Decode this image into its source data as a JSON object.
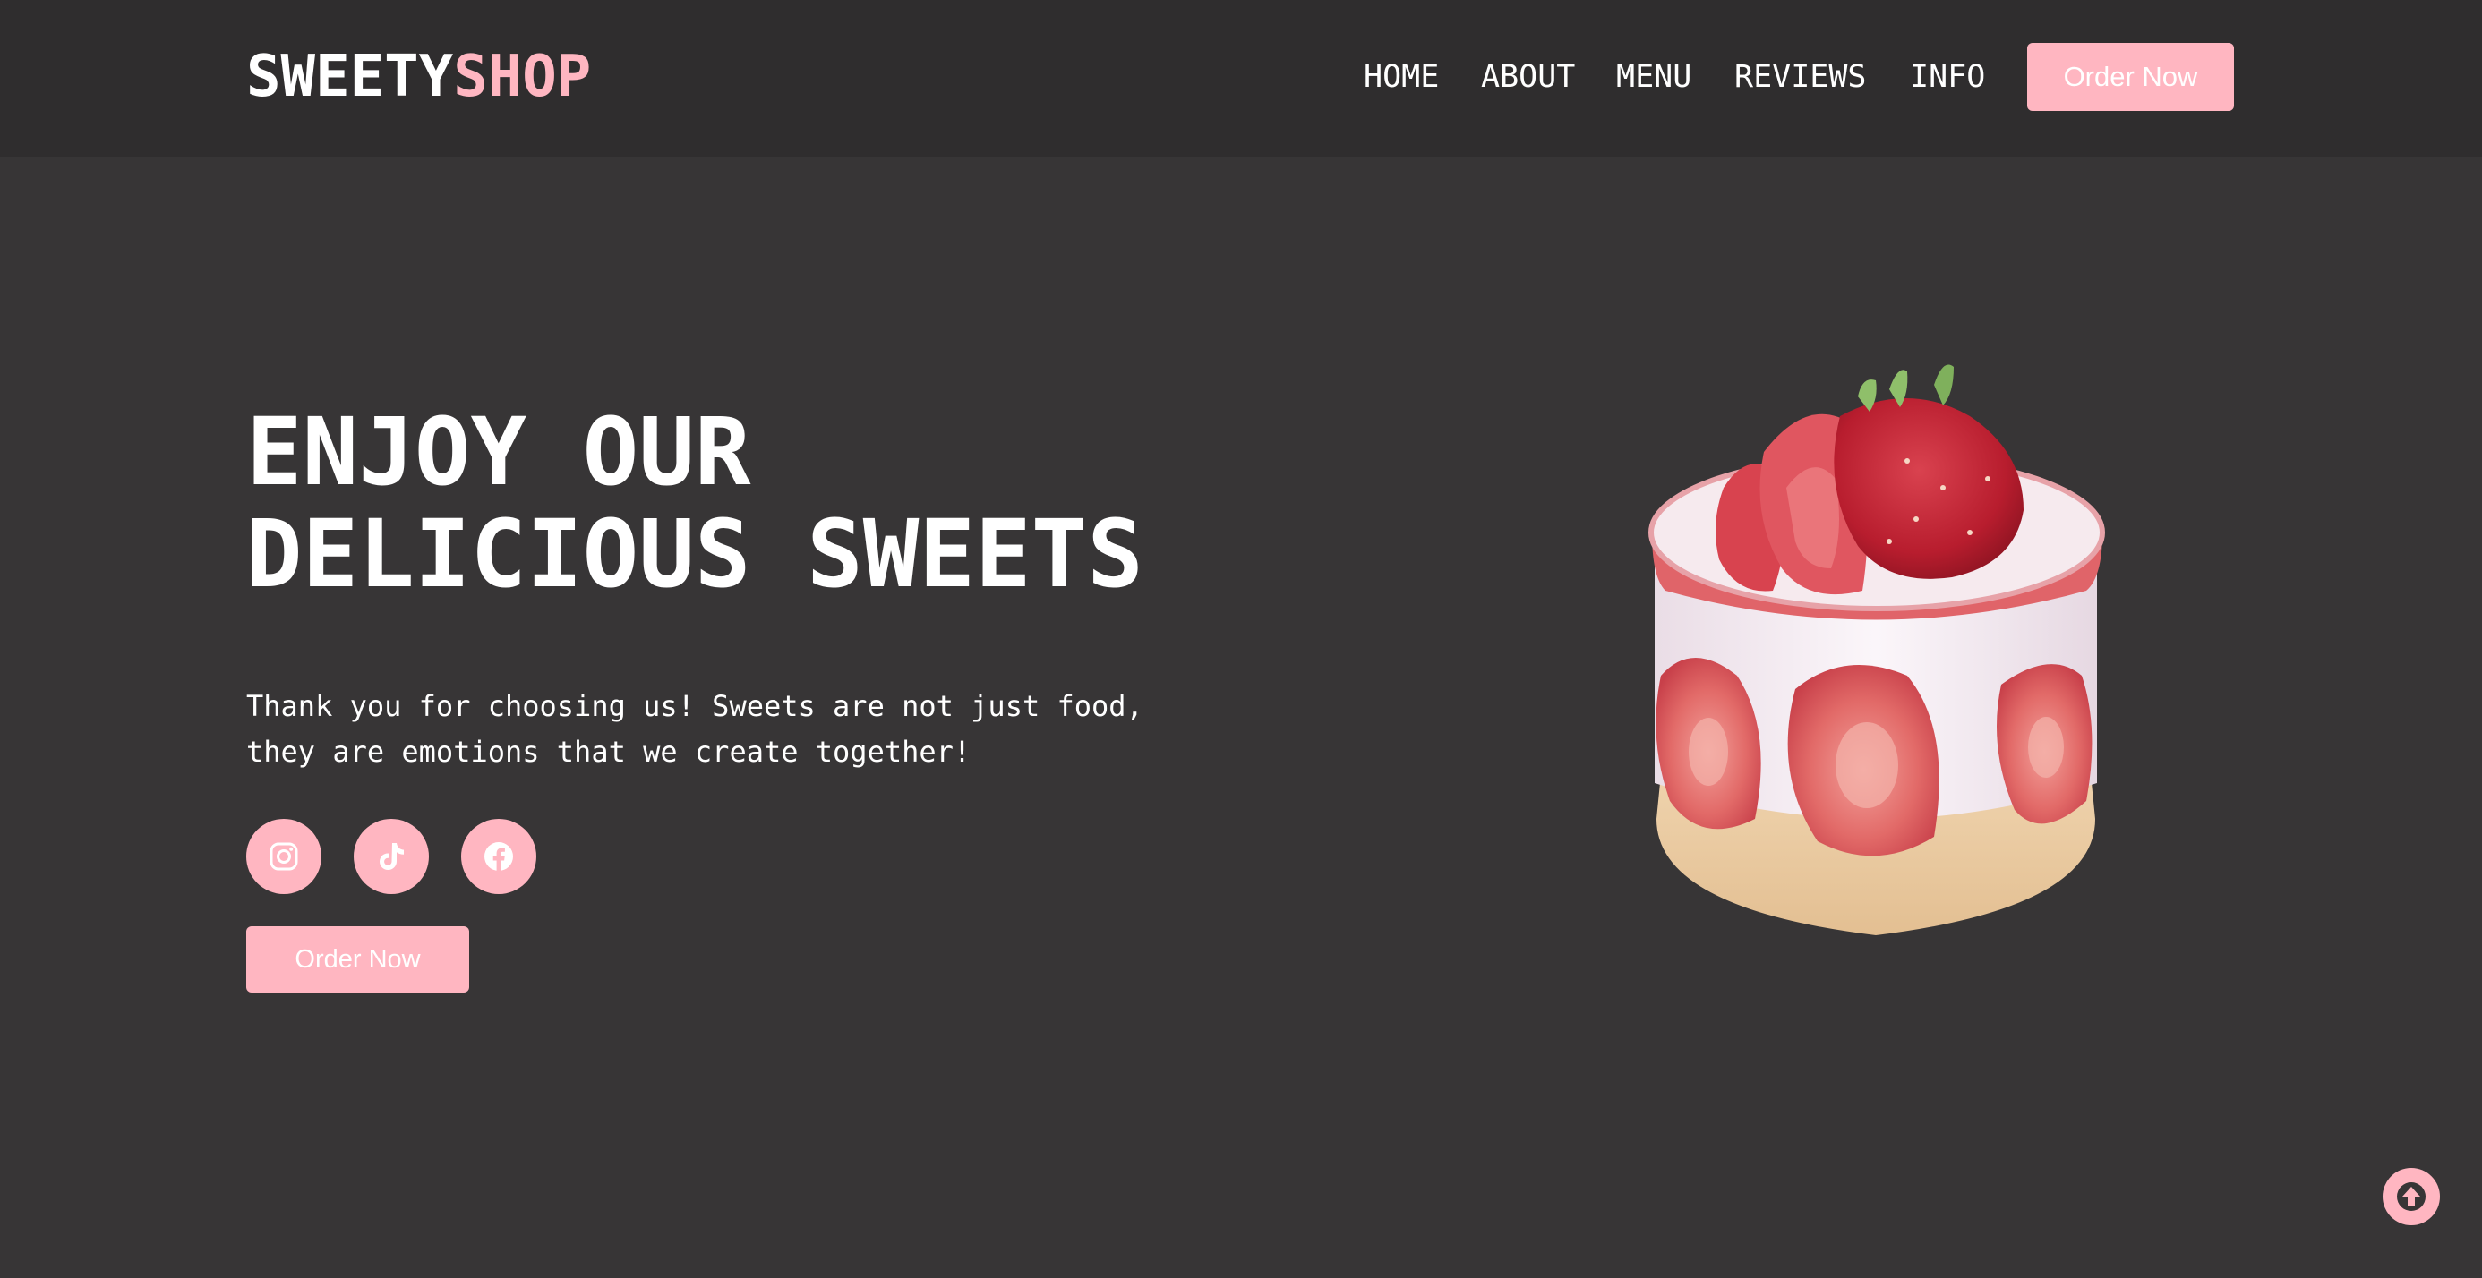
{
  "header": {
    "logo_part1": "SWEETY",
    "logo_part2": "SHOP",
    "nav": [
      {
        "label": "HOME"
      },
      {
        "label": "ABOUT"
      },
      {
        "label": "MENU"
      },
      {
        "label": "REVIEWS"
      },
      {
        "label": "INFO"
      }
    ],
    "order_button": "Order Now"
  },
  "hero": {
    "title_line1": "ENJOY OUR",
    "title_line2": "DELICIOUS SWEETS",
    "text_line1": "Thank you for choosing us! Sweets are not just food,",
    "text_line2": "they are emotions that we create together!",
    "social": [
      {
        "icon": "instagram-icon"
      },
      {
        "icon": "tiktok-icon"
      },
      {
        "icon": "facebook-icon"
      }
    ],
    "order_button": "Order Now",
    "image": "strawberry-cake-image"
  },
  "scroll_top": {
    "icon": "arrow-up-icon"
  },
  "colors": {
    "background": "#373536",
    "header_background": "#2f2d2e",
    "accent": "#ffb6c1",
    "text": "#ffffff"
  }
}
